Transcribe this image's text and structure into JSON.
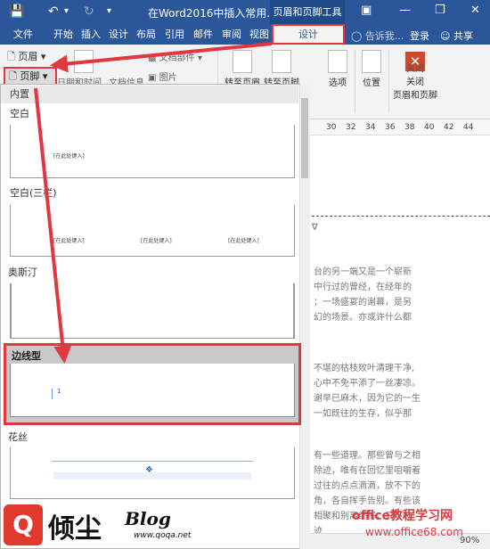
{
  "titlebar": {
    "save_icon": "save-icon",
    "undo_icon": "undo-icon",
    "redo_icon": "redo-icon",
    "document_title": "在Word2016中插入常用...",
    "context_tab_title": "页眉和页脚工具",
    "ribbon_options_icon": "ribbon-display-options-icon",
    "minimize_icon": "minimize-icon",
    "restore_icon": "restore-icon",
    "close_icon": "close-icon",
    "colors": {
      "bar": "#2b579a",
      "context": "#1e4a86"
    }
  },
  "tabs": [
    {
      "label": "文件"
    },
    {
      "label": "开始"
    },
    {
      "label": "插入"
    },
    {
      "label": "设计"
    },
    {
      "label": "布局"
    },
    {
      "label": "引用"
    },
    {
      "label": "邮件"
    },
    {
      "label": "审阅"
    },
    {
      "label": "视图"
    },
    {
      "label": "设计",
      "active": true
    }
  ],
  "tabbar_right": {
    "tell_me": "告诉我...",
    "login": "登录",
    "share": "共享"
  },
  "ribbon": {
    "header_button": "页眉",
    "footer_button": "页脚",
    "date_time": "日期和时间",
    "doc_info": "文档信息",
    "doc_parts": "文档部件",
    "picture": "图片",
    "goto_header": "转至页眉",
    "goto_footer": "转至页脚",
    "options": "选项",
    "position": "位置",
    "close_line1": "关闭",
    "close_line2": "页眉和页脚",
    "close_group": "关闭"
  },
  "gallery": {
    "section_builtin": "内置",
    "items": [
      {
        "label": "空白",
        "placeholders": [
          "[在此处键入]"
        ]
      },
      {
        "label": "空白(三栏)",
        "placeholders": [
          "[在此处键入]",
          "[在此处键入]",
          "[在此处键入]"
        ]
      },
      {
        "label": "奥斯汀"
      },
      {
        "label": "边线型",
        "page_number": "1",
        "selected": true
      },
      {
        "label": "花丝"
      }
    ]
  },
  "ruler": [
    "30",
    "32",
    "34",
    "36",
    "38",
    "40",
    "42",
    "44"
  ],
  "document_text": [
    "台的另一端又是一个崭新",
    "中行过的曾经，在经年的",
    "；一场盛宴的谢幕，是另",
    "幻的场景。亦或许什么都",
    "不堪的枯枝败叶清理干净,",
    "心中不免平添了一丝凄凉。",
    "谢早已麻木，因为它的一生",
    "一如既往的生存，似乎那",
    "有一些道理。那些曾与之相",
    "除迹，唯有在回忆里咀嚼着",
    "过往的点点滴滴，放不下的",
    "角，各自挥手告别。有些该",
    "相聚和别离终将，只不过",
    "迹"
  ],
  "watermarks": {
    "logo_letter": "Q",
    "blog_cn": "倾尘",
    "blog_word": "Blog",
    "blog_url": "www.qoqa.net",
    "office_site": "office教程学习网",
    "office_url": "www.office68.com"
  },
  "status": {
    "zoom": "90%"
  },
  "accent_color": "#e0383e"
}
